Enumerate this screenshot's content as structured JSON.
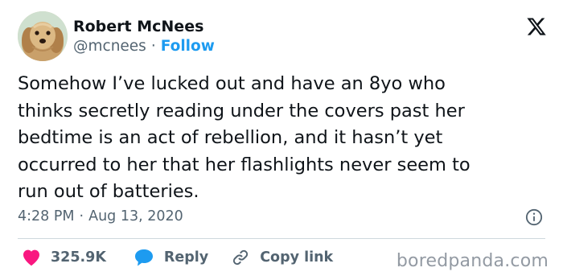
{
  "author": {
    "display_name": "Robert McNees",
    "handle": "@mcnees",
    "separator": "·",
    "follow_label": "Follow"
  },
  "tweet": {
    "text": "Somehow I’ve lucked out and have an 8yo who\nthinks secretly reading under the covers past her\nbedtime is an act of rebellion, and it hasn’t yet\noccurred to her that her flashlights never seem to\nrun out of batteries."
  },
  "meta": {
    "time": "4:28 PM",
    "separator": "·",
    "date": "Aug 13, 2020"
  },
  "actions": {
    "likes_count": "325.9K",
    "reply_label": "Reply",
    "copy_link_label": "Copy link"
  },
  "watermark": "boredpanda.com",
  "icons": {
    "logo": "x-logo-icon",
    "info": "info-icon",
    "like": "heart-icon",
    "reply": "reply-bubble-icon",
    "copy": "link-icon"
  },
  "colors": {
    "text": "#0f1419",
    "secondary": "#536471",
    "follow": "#1d9bf0",
    "heart": "#f91880",
    "reply_bubble": "#1d9bf0",
    "divider": "#cfd9de",
    "watermark": "#939aa3"
  }
}
